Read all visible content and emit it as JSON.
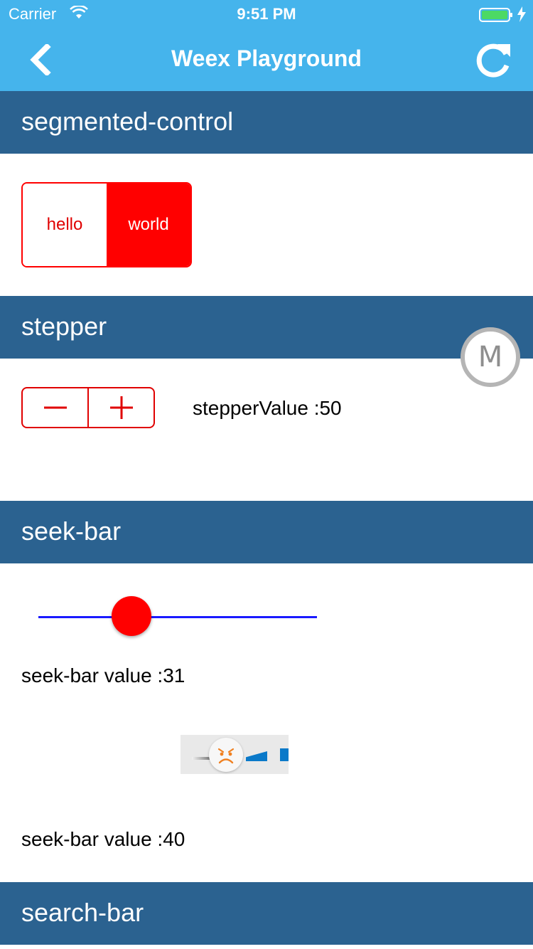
{
  "status_bar": {
    "carrier": "Carrier",
    "time": "9:51 PM"
  },
  "nav": {
    "title": "Weex Playground"
  },
  "sections": {
    "segmented_control": {
      "header": "segmented-control",
      "items": [
        "hello",
        "world"
      ],
      "selected_index": 1
    },
    "stepper": {
      "header": "stepper",
      "value_text": "stepperValue :50"
    },
    "seek_bar": {
      "header": "seek-bar",
      "value_fraction": 0.31,
      "value_text_1": "seek-bar value :31",
      "value_text_2": "seek-bar value :40"
    },
    "search_bar": {
      "header": "search-bar"
    }
  },
  "floating_button": {
    "letter": "M"
  },
  "colors": {
    "nav_bg": "#45b4ec",
    "section_header_bg": "#2b6290",
    "accent_red": "#ff0000",
    "track_blue": "#1a1aff"
  }
}
